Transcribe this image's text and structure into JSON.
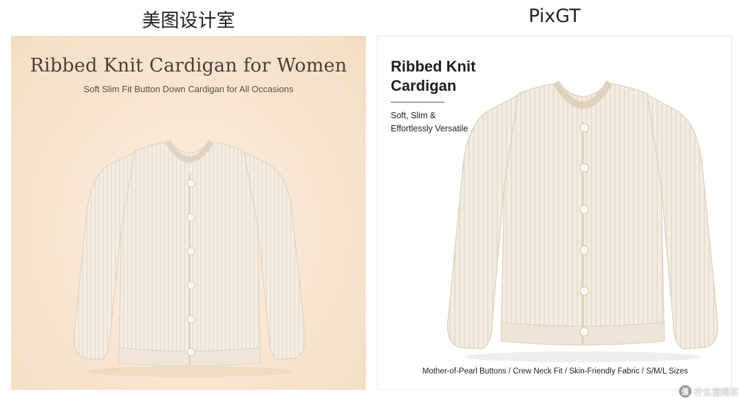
{
  "labels": {
    "left": "美图设计室",
    "right": "PixGT"
  },
  "left_panel": {
    "title": "Ribbed Knit Cardigan for Women",
    "subtitle": "Soft Slim Fit Button Down Cardigan for All Occasions",
    "background_color": "#f6e2cc"
  },
  "right_panel": {
    "title_line1": "Ribbed Knit",
    "title_line2": "Cardigan",
    "subtitle_line1": "Soft, Slim &",
    "subtitle_line2": "Effortlessly Versatile",
    "features": "Mother-of-Pearl Buttons / Crew Neck Fit / Skin-Friendly Fabric / S/M/L Sizes"
  },
  "product": {
    "garment_color": "#f3ebe0",
    "icon": "cardigan-icon"
  },
  "watermark": {
    "badge": "值",
    "text": "什么值得买"
  }
}
